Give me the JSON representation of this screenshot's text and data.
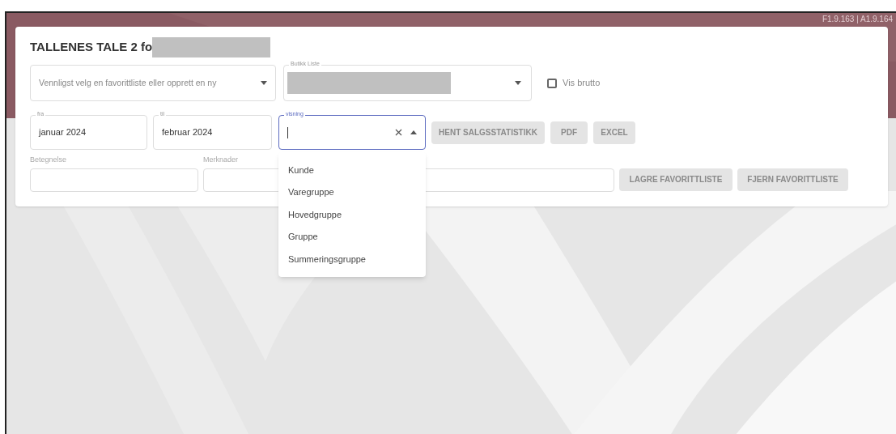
{
  "version": "F1.9.163 | A1.9.164",
  "title": "TALLENES TALE 2 fo",
  "favorite_select": {
    "placeholder": "Vennligst velg en favorittliste eller opprett en ny"
  },
  "store_select": {
    "label": "Butikk Liste"
  },
  "show_gross": {
    "label": "Vis brutto",
    "checked": false
  },
  "from_field": {
    "label": "fra",
    "value": "januar 2024"
  },
  "to_field": {
    "label": "til",
    "value": "februar 2024"
  },
  "view_field": {
    "label": "visning",
    "focused": true,
    "expanded": true
  },
  "action_buttons": [
    {
      "label": "HENT SALGSSTATISTIKK",
      "disabled": true
    },
    {
      "label": "PDF",
      "disabled": true
    },
    {
      "label": "EXCEL",
      "disabled": true
    }
  ],
  "name_field": {
    "label": "Betegnelse"
  },
  "notes_field": {
    "label": "Merknader"
  },
  "favorite_buttons": [
    {
      "label": "LAGRE FAVORITTLISTE",
      "disabled": true
    },
    {
      "label": "FJERN FAVORITTLISTE",
      "disabled": true
    }
  ],
  "view_options": [
    "Kunde",
    "Varegruppe",
    "Hovedgruppe",
    "Gruppe",
    "Summeringsgruppe"
  ]
}
